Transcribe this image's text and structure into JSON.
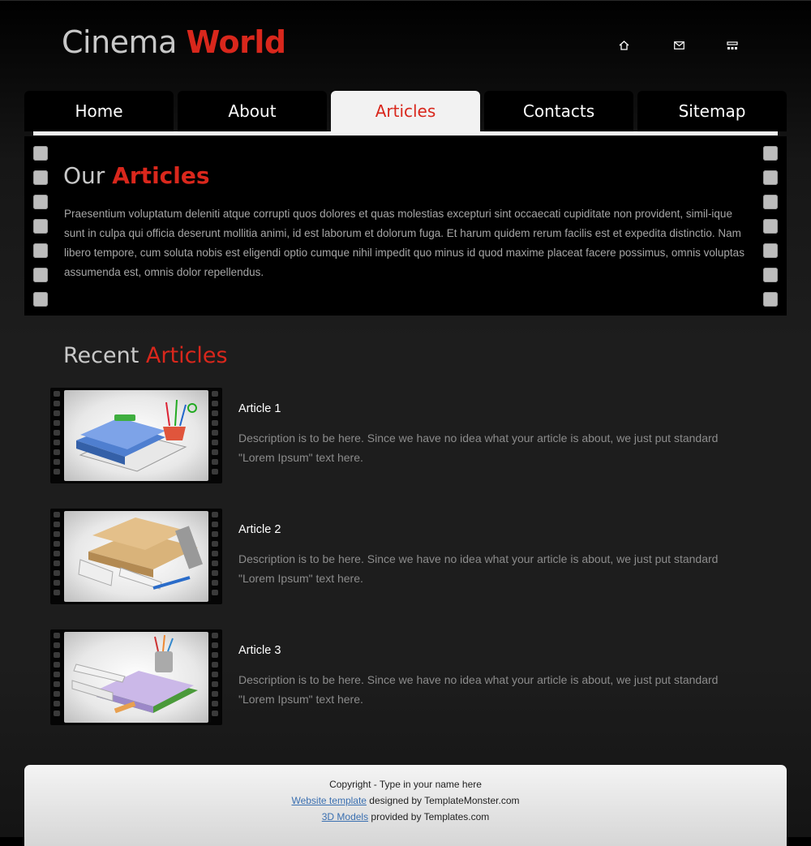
{
  "logo": {
    "word1": "Cinema",
    "word2": "World"
  },
  "top_icons": [
    "home-icon",
    "mail-icon",
    "sitemap-icon"
  ],
  "nav": {
    "tabs": [
      {
        "label": "Home",
        "active": false
      },
      {
        "label": "About",
        "active": false
      },
      {
        "label": "Articles",
        "active": true
      },
      {
        "label": "Contacts",
        "active": false
      },
      {
        "label": "Sitemap",
        "active": false
      }
    ]
  },
  "intro": {
    "title_a": "Our",
    "title_b": "Articles",
    "text": "Praesentium voluptatum deleniti atque corrupti quos dolores et quas molestias excepturi sint occaecati cupiditate non provident, simil-ique sunt in culpa qui officia deserunt mollitia animi, id est laborum et dolorum fuga. Et harum quidem rerum facilis est et expedita distinctio. Nam libero tempore, cum soluta nobis est eligendi optio cumque nihil impedit quo minus id quod maxime placeat facere possimus, omnis voluptas assumenda est, omnis dolor repellendus."
  },
  "recent": {
    "title_a": "Recent",
    "title_b": "Articles",
    "articles": [
      {
        "title": "Article 1",
        "description": "Description is to be here. Since we have no idea what your article is about, we just put standard \"Lorem Ipsum\" text here."
      },
      {
        "title": "Article 2",
        "description": "Description is to be here. Since we have no idea what your article is about, we just put standard \"Lorem Ipsum\" text here."
      },
      {
        "title": "Article 3",
        "description": "Description is to be here. Since we have no idea what your article is about, we just put standard \"Lorem Ipsum\" text here."
      }
    ]
  },
  "footer": {
    "copyright": "Copyright - Type in your name here",
    "link1": "Website template",
    "text1": " designed by TemplateMonster.com",
    "link2": "3D Models",
    "text2": " provided by Templates.com"
  },
  "colors": {
    "accent": "#d9271c",
    "panel": "#000000",
    "tab_active_bg": "#f2f2f2"
  }
}
